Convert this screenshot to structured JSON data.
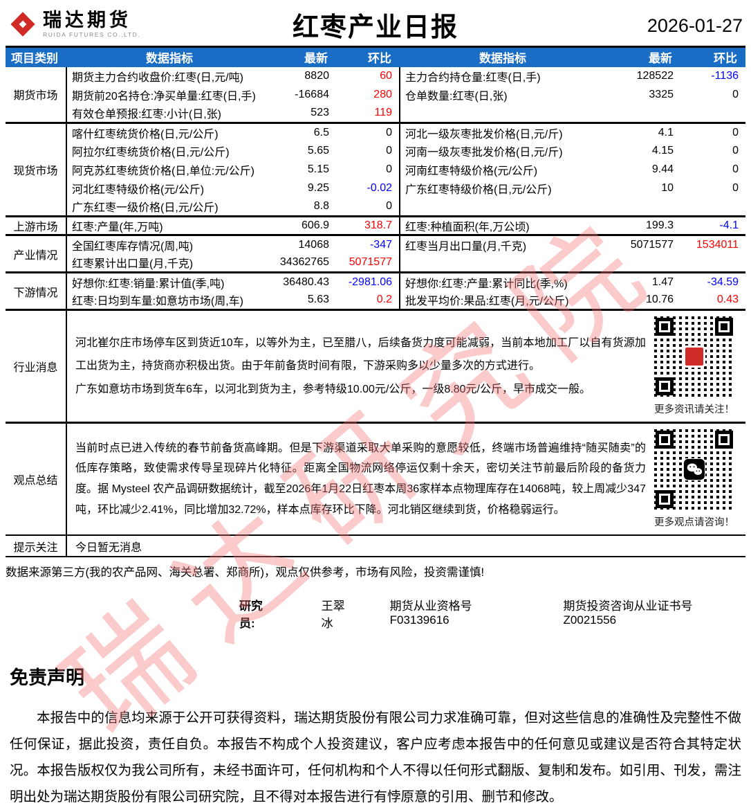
{
  "palette": {
    "up-red": "#fe0000",
    "down-blue": "#0000fe",
    "black": "#000000",
    "header-blue": "#1a6dc4",
    "brand-red": "#d02a27",
    "watermark-pink": "#f67878"
  },
  "watermark": {
    "text": "瑞达研究院"
  },
  "header": {
    "brand_cn": "瑞达期货",
    "brand_en": "RUIDA FUTURES CO.,LTD.",
    "title": "红枣产业日报",
    "date": "2026-01-27"
  },
  "table": {
    "columns": {
      "category": "项目类别",
      "indicator": "数据指标",
      "latest": "最新",
      "chg": "环比"
    },
    "sections": [
      {
        "category": "期货市场",
        "rows": [
          {
            "left": {
              "label": "期货主力合约收盘价:红枣(日,元/吨)",
              "latest": "8820",
              "chg": "60",
              "chg_color": "up-red"
            },
            "right": {
              "label": "主力合约持仓量:红枣(日,手)",
              "latest": "128522",
              "chg": "-1136",
              "chg_color": "down-blue"
            }
          },
          {
            "left": {
              "label": "期货前20名持仓:净买单量:红枣(日,手)",
              "latest": "-16684",
              "chg": "280",
              "chg_color": "up-red"
            },
            "right": {
              "label": "仓单数量:红枣(日,张)",
              "latest": "3325",
              "chg": "0",
              "chg_color": "black"
            }
          },
          {
            "left": {
              "label": "有效仓单预报:红枣:小计(日,张)",
              "latest": "523",
              "chg": "119",
              "chg_color": "up-red"
            },
            "right": null
          }
        ]
      },
      {
        "category": "现货市场",
        "rows": [
          {
            "left": {
              "label": "喀什红枣统货价格(日,元/公斤)",
              "latest": "6.5",
              "chg": "0",
              "chg_color": "black"
            },
            "right": {
              "label": "河北一级灰枣批发价格(日,元/斤)",
              "latest": "4.1",
              "chg": "0",
              "chg_color": "black"
            }
          },
          {
            "left": {
              "label": "阿拉尔红枣统货价格(日,元/公斤)",
              "latest": "5.65",
              "chg": "0",
              "chg_color": "black"
            },
            "right": {
              "label": "河南一级灰枣批发价格(日,元/斤)",
              "latest": "4.15",
              "chg": "0",
              "chg_color": "black"
            }
          },
          {
            "left": {
              "label": "阿克苏红枣统货价格(日,单位:元/公斤)",
              "latest": "5.15",
              "chg": "0",
              "chg_color": "black"
            },
            "right": {
              "label": "河南红枣特级价格(元/公斤)",
              "latest": "9.44",
              "chg": "0",
              "chg_color": "black"
            }
          },
          {
            "left": {
              "label": "河北红枣特级价格(元/公斤)",
              "latest": "9.25",
              "chg": "-0.02",
              "chg_color": "down-blue"
            },
            "right": {
              "label": "广东红枣特级价格(日,元/公斤)",
              "latest": "10",
              "chg": "0",
              "chg_color": "black"
            }
          },
          {
            "left": {
              "label": "广东红枣一级价格(日,元/公斤)",
              "latest": "8.8",
              "chg": "0",
              "chg_color": "black"
            },
            "right": null
          }
        ]
      },
      {
        "category": "上游市场",
        "rows": [
          {
            "left": {
              "label": "红枣:产量(年,万吨)",
              "latest": "606.9",
              "chg": "318.7",
              "chg_color": "up-red"
            },
            "right": {
              "label": "红枣:种植面积(年,万公顷)",
              "latest": "199.3",
              "chg": "-4.1",
              "chg_color": "down-blue"
            }
          }
        ]
      },
      {
        "category": "产业情况",
        "rows": [
          {
            "left": {
              "label": "全国红枣库存情况(周,吨)",
              "latest": "14068",
              "chg": "-347",
              "chg_color": "down-blue"
            },
            "right": {
              "label": "红枣当月出口量(月,千克)",
              "latest": "5071577",
              "chg": "1534011",
              "chg_color": "up-red"
            }
          },
          {
            "left": {
              "label": "红枣累计出口量(月,千克)",
              "latest": "34362765",
              "chg": "5071577",
              "chg_color": "up-red"
            },
            "right": null
          }
        ]
      },
      {
        "category": "下游情况",
        "rows": [
          {
            "left": {
              "label": "好想你:红枣:销量:累计值(季,吨)",
              "latest": "36480.43",
              "chg": "-2981.06",
              "chg_color": "down-blue"
            },
            "right": {
              "label": "好想你:红枣:产量:累计同比(季,%)",
              "latest": "1.47",
              "chg": "-34.59",
              "chg_color": "down-blue"
            }
          },
          {
            "left": {
              "label": "红枣:日均到车量:如意坊市场(周,车)",
              "latest": "5.63",
              "chg": "0.2",
              "chg_color": "up-red"
            },
            "right": {
              "label": "批发平均价:果品:红枣(月,元/公斤)",
              "latest": "10.76",
              "chg": "0.43",
              "chg_color": "up-red"
            }
          }
        ]
      }
    ]
  },
  "industry_news": {
    "category": "行业消息",
    "paragraphs": [
      "河北崔尔庄市场停车区到货近10车，以等外为主，已至腊八，后续备货力度可能减弱，当前本地加工厂以自有货源加工出货为主，持货商亦积极出货。由于年前备货时间有限，下游采购多以少量多次的方式进行。",
      "广东如意坊市场到货车6车，以河北到货为主，参考特级10.00元/公斤，一级8.80元/公斤，早市成交一般。"
    ],
    "qr_caption": "更多资讯请关注！"
  },
  "viewpoint": {
    "category": "观点总结",
    "paragraphs": [
      "当前时点已进入传统的春节前备货高峰期。但是下游渠道采取大单采购的意愿较低，终端市场普遍维持“随买随卖”的低库存策略，致使需求传导呈现碎片化特征。距离全国物流网络停运仅剩十余天，密切关注节前最后阶段的备货力度。据 Mysteel 农产品调研数据统计，截至2026年1月22日红枣本周36家样本点物理库存在14068吨，较上周减少347吨，环比减少2.41%，同比增加32.72%，样本点库存环比下降。河北销区继续到货，价格稳弱运行。"
    ],
    "qr_caption": "更多观点请咨询！"
  },
  "tips": {
    "category": "提示关注",
    "text": "今日暂无消息"
  },
  "footer": {
    "source": "数据来源第三方(我的农产品网、海关总署、郑商所)，观点仅供参考，市场有风险，投资需谨慎!",
    "researcher_label": "研究员:",
    "researcher_name": "王翠冰",
    "cert1": "期货从业资格号F03139616",
    "cert2": "期货投资咨询从业证书号Z0021556"
  },
  "disclaimer": {
    "title": "免责声明",
    "body": "本报告中的信息均来源于公开可获得资料，瑞达期货股份有限公司力求准确可靠，但对这些信息的准确性及完整性不做任何保证，据此投资，责任自负。本报告不构成个人投资建议，客户应考虑本报告中的任何意见或建议是否符合其特定状况。本报告版权仅为我公司所有，未经书面许可，任何机构和个人不得以任何形式翻版、复制和发布。如引用、刊发，需注明出处为瑞达期货股份有限公司研究院，且不得对本报告进行有悖原意的引用、删节和修改。"
  }
}
